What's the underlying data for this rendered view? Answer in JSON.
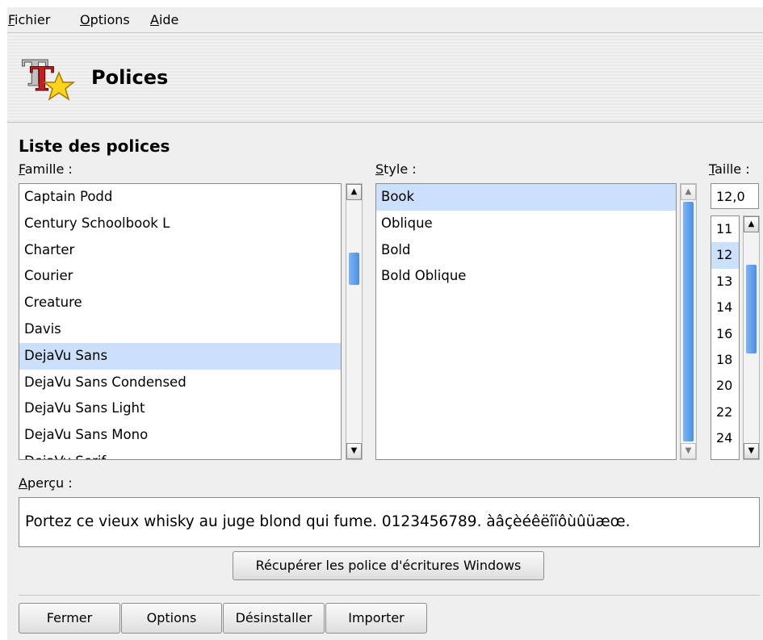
{
  "menubar": {
    "items": [
      "Fichier",
      "Options",
      "Aide"
    ]
  },
  "header": {
    "title": "Polices",
    "icon": "font-tt-star-icon"
  },
  "section": {
    "title": "Liste des polices"
  },
  "family": {
    "label": "Famille :",
    "items": [
      {
        "label": "Captain Podd",
        "selected": false
      },
      {
        "label": "Century Schoolbook L",
        "selected": false
      },
      {
        "label": "Charter",
        "selected": false
      },
      {
        "label": "Courier",
        "selected": false
      },
      {
        "label": "Creature",
        "selected": false
      },
      {
        "label": "Davis",
        "selected": false
      },
      {
        "label": "DejaVu Sans",
        "selected": true
      },
      {
        "label": "DejaVu Sans Condensed",
        "selected": false
      },
      {
        "label": "DejaVu Sans Light",
        "selected": false
      },
      {
        "label": "DejaVu Sans Mono",
        "selected": false
      },
      {
        "label": "DejaVu Serif",
        "selected": false
      }
    ]
  },
  "style": {
    "label": "Style :",
    "items": [
      {
        "label": "Book",
        "selected": true
      },
      {
        "label": "Oblique",
        "selected": false
      },
      {
        "label": "Bold",
        "selected": false
      },
      {
        "label": "Bold Oblique",
        "selected": false
      }
    ]
  },
  "size": {
    "label": "Taille :",
    "value": "12,0",
    "items": [
      {
        "label": "11",
        "selected": false
      },
      {
        "label": "12",
        "selected": true
      },
      {
        "label": "13",
        "selected": false
      },
      {
        "label": "14",
        "selected": false
      },
      {
        "label": "16",
        "selected": false
      },
      {
        "label": "18",
        "selected": false
      },
      {
        "label": "20",
        "selected": false
      },
      {
        "label": "22",
        "selected": false
      },
      {
        "label": "24",
        "selected": false
      }
    ]
  },
  "preview": {
    "label": "Aperçu :",
    "text": "Portez ce vieux whisky au juge blond qui fume. 0123456789. àâçèéêëîïôùûüæœ."
  },
  "buttons": {
    "windows_fonts": "Récupérer les police d'écritures Windows",
    "close": "Fermer",
    "options": "Options",
    "uninstall": "Désinstaller",
    "import": "Importer"
  },
  "colors": {
    "selection": "#cbe0fb",
    "scroll_thumb": "#4a90e6"
  }
}
